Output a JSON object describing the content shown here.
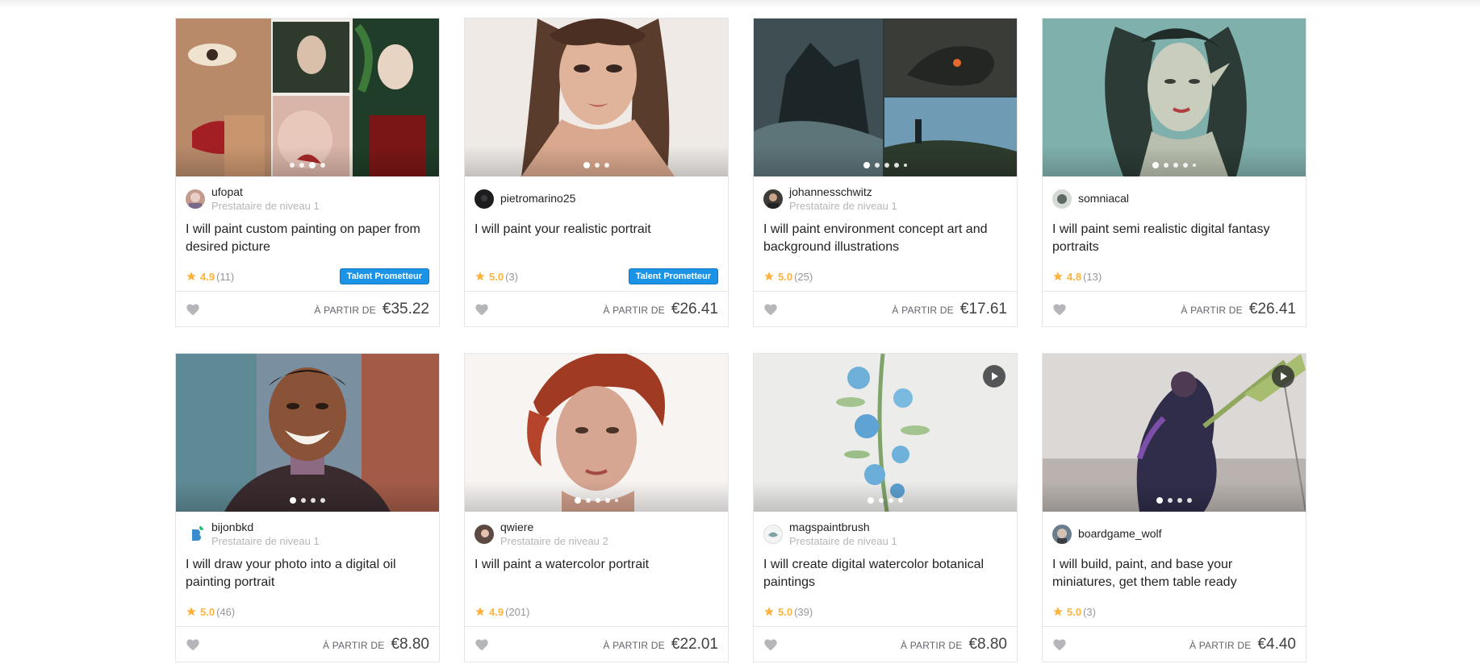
{
  "colors": {
    "star": "#ffb33e",
    "badge": "#1b93e6",
    "heart": "#b5b6ba",
    "online": "#1dbf73"
  },
  "price_label": "À PARTIR DE",
  "gigs": [
    {
      "seller": "ufopat",
      "level": "Prestataire de niveau 1",
      "title": "I will paint custom painting on paper from desired picture",
      "score": "4.9",
      "count": "(11)",
      "badge": "Talent Prometteur",
      "price": "€35.22",
      "dots": 4,
      "active_dot": 2,
      "video": false,
      "icon": "heart-icon"
    },
    {
      "seller": "pietromarino25",
      "level": "",
      "title": "I will paint your realistic portrait",
      "score": "5.0",
      "count": "(3)",
      "badge": "Talent Prometteur",
      "price": "€26.41",
      "dots": 3,
      "active_dot": 0,
      "video": false,
      "icon": "heart-icon"
    },
    {
      "seller": "johannesschwitz",
      "level": "Prestataire de niveau 1",
      "title": "I will paint environment concept art and background illustrations",
      "score": "5.0",
      "count": "(25)",
      "badge": "",
      "price": "€17.61",
      "dots": 5,
      "active_dot": 0,
      "video": false,
      "icon": "heart-icon"
    },
    {
      "seller": "somniacal",
      "level": "",
      "title": "I will paint semi realistic digital fantasy portraits",
      "score": "4.8",
      "count": "(13)",
      "badge": "",
      "price": "€26.41",
      "dots": 5,
      "active_dot": 0,
      "video": false,
      "icon": "heart-icon"
    },
    {
      "seller": "bijonbkd",
      "level": "Prestataire de niveau 1",
      "title": "I will draw your photo into a digital oil painting portrait",
      "score": "5.0",
      "count": "(46)",
      "badge": "",
      "price": "€8.80",
      "dots": 4,
      "active_dot": 0,
      "video": false,
      "icon": "heart-icon"
    },
    {
      "seller": "qwiere",
      "level": "Prestataire de niveau 2",
      "title": "I will paint a watercolor portrait",
      "score": "4.9",
      "count": "(201)",
      "badge": "",
      "price": "€22.01",
      "dots": 5,
      "active_dot": 0,
      "video": false,
      "icon": "heart-icon"
    },
    {
      "seller": "magspaintbrush",
      "level": "Prestataire de niveau 1",
      "title": "I will create digital watercolor botanical paintings",
      "score": "5.0",
      "count": "(39)",
      "badge": "",
      "price": "€8.80",
      "dots": 4,
      "active_dot": 0,
      "video": true,
      "icon": "heart-icon"
    },
    {
      "seller": "boardgame_wolf",
      "level": "",
      "title": "I will build, paint, and base your miniatures, get them table ready",
      "score": "5.0",
      "count": "(3)",
      "badge": "",
      "price": "€4.40",
      "dots": 4,
      "active_dot": 0,
      "video": true,
      "icon": "heart-icon"
    }
  ]
}
